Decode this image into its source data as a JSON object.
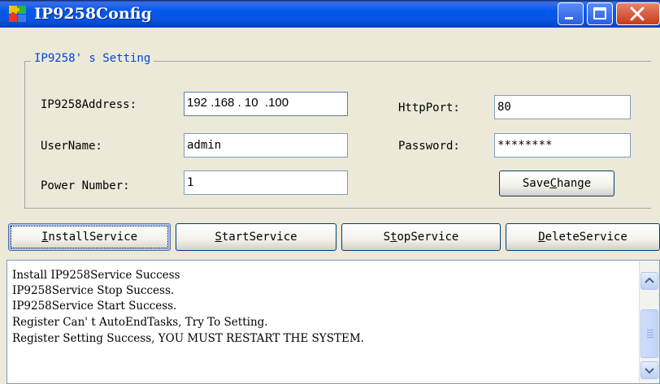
{
  "window": {
    "title": "IP9258Config",
    "accent": "#0058EE",
    "close_color": "#C93A1C",
    "icons": {
      "app": "puzzle-app-icon",
      "minimize": "minimize-icon",
      "maximize": "maximize-icon",
      "close": "close-icon"
    }
  },
  "settings": {
    "legend": "IP9258' s Setting",
    "ip_label": "IP9258Address:",
    "ip_value": "192 .168 . 10  .100",
    "httpport_label": "HttpPort:",
    "httpport_value": "80",
    "username_label": "UserName:",
    "username_value": "admin",
    "password_label": "Password:",
    "password_value": "********",
    "power_label": "Power Number:",
    "power_value": "1",
    "save_pre": "Save",
    "save_key": "C",
    "save_post": "hange"
  },
  "service_buttons": {
    "install_key": "I",
    "install_rest": "nstallService",
    "start_key": "S",
    "start_rest": "tartService",
    "stop_pre": "S",
    "stop_key": "t",
    "stop_post": "opService",
    "delete_key": "D",
    "delete_rest": "eleteService"
  },
  "log": {
    "lines": [
      "Install IP9258Service Success",
      "IP9258Service Stop Success.",
      "IP9258Service Start Success.",
      "Register Can' t AutoEndTasks, Try To Setting.",
      "Register Setting Success, YOU MUST RESTART THE SYSTEM."
    ]
  },
  "scrollbar": {
    "up_icon": "scroll-up-arrow-icon",
    "down_icon": "scroll-down-arrow-icon",
    "thumb_icon": "scroll-thumb-grip-icon"
  }
}
